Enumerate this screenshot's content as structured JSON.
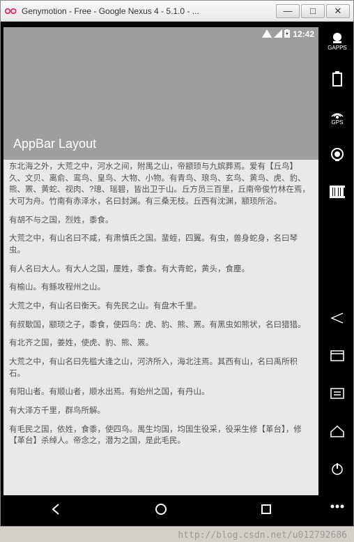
{
  "window": {
    "title": "Genymotion - Free - Google Nexus 4 - 5.1.0 - ..."
  },
  "status_bar": {
    "time": "12:42"
  },
  "app": {
    "title": "AppBar Layout"
  },
  "content": {
    "p1": "东北海之外，大荒之中，河水之间，附禺之山，帝颛顼与九嫔葬焉。爱有【丘鸟】久、文贝、离俞、鸾鸟、皇鸟、大物、小物。有青鸟、琅鸟、玄鸟、黄鸟、虎、豹、熊、罴、黄蛇、视肉、?璁、瑶碧，皆出卫于山。丘方员三百里，丘南帝俊竹林在焉，大可为舟。竹南有赤泽水，名曰封渊。有三桑无枝。丘西有沈渊，颛顼所浴。",
    "p2": "有胡不与之国，烈姓，黍食。",
    "p3": "大荒之中，有山名曰不咸，有肃慎氏之国。蜚蛭，四翼。有虫，兽身蛇身，名曰琴虫。",
    "p4": "有人名曰大人。有大人之国，厘姓，黍食。有大青蛇，黄头，食麈。",
    "p5": "有榆山。有鲧攻程州之山。",
    "p6": "大荒之中，有山名曰衡天。有先民之山。有盘木千里。",
    "p7": "有叔歜国，颛顼之子，黍食，使四鸟：虎、豹、熊、罴。有黑虫如熊状，名曰猎猎。",
    "p8": "有北齐之国，姜姓，使虎、豹、熊、罴。",
    "p9": "大荒之中，有山名曰先槛大逢之山，河济所入，海北注焉。其西有山，名曰禹所积石。",
    "p10": "有阳山者。有顺山者，顺水出焉。有始州之国，有丹山。",
    "p11": "有大泽方千里，群鸟所解。",
    "p12": "有毛民之国，依姓，食黍，使四鸟。禺生均国，均国生役采，役采生修【革台】，修【革台】杀绰人。帝念之，潜为之国，是此毛民。"
  },
  "sidebar": {
    "gapps": "GAPPS",
    "gps": "GPS"
  },
  "watermark": "http://blog.csdn.net/u012792686"
}
